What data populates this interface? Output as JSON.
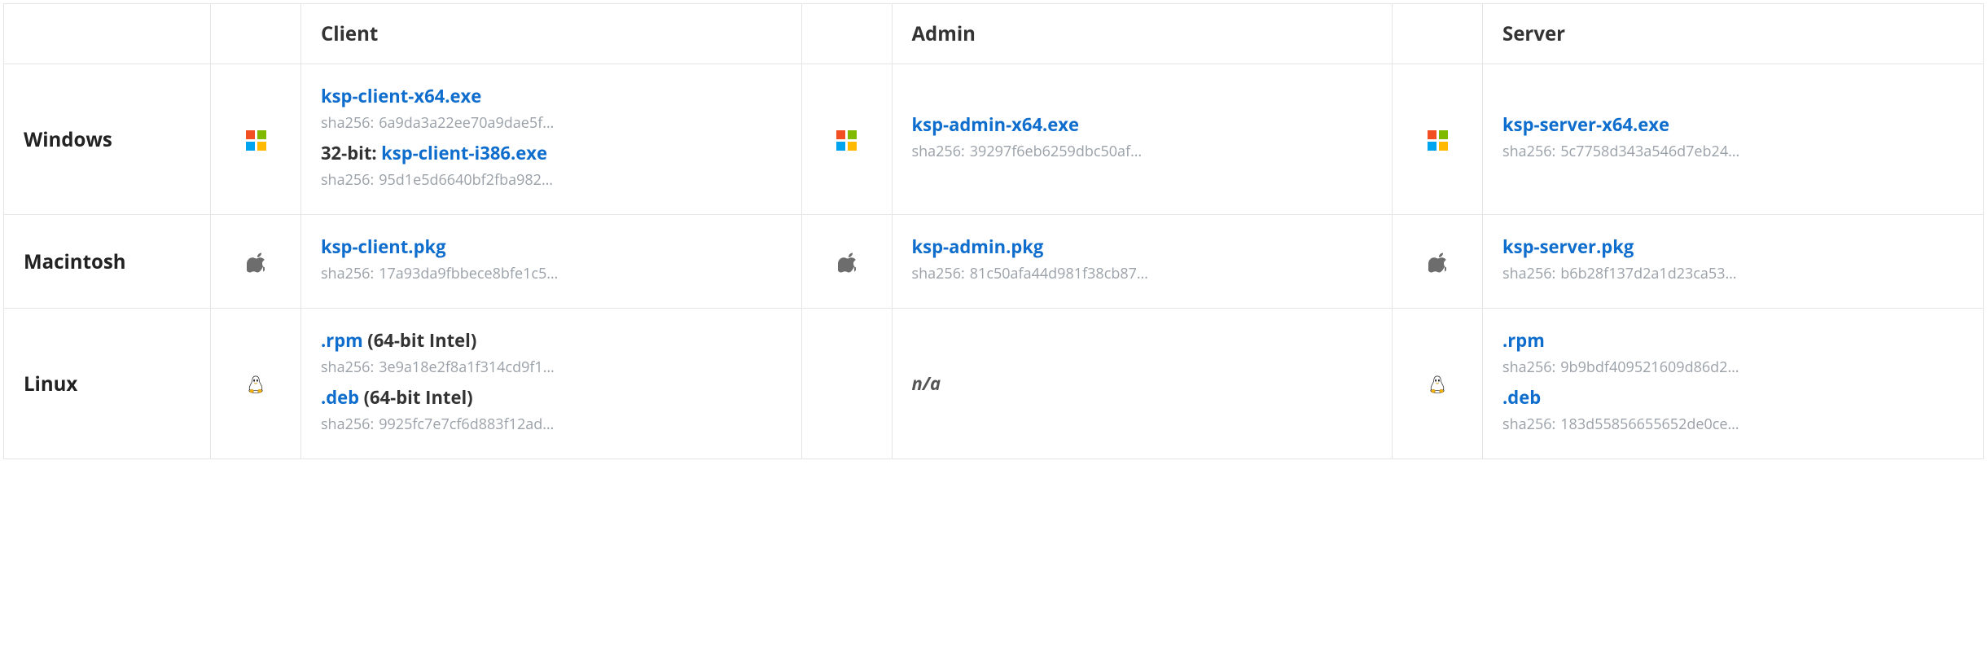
{
  "headers": {
    "client": "Client",
    "admin": "Admin",
    "server": "Server"
  },
  "os": {
    "windows": "Windows",
    "mac": "Macintosh",
    "linux": "Linux"
  },
  "labels": {
    "sha_prefix": "sha256:",
    "bit32_prefix": "32-bit:",
    "arch64_intel": "(64-bit Intel)",
    "na": "n/a"
  },
  "downloads": {
    "windows": {
      "client": {
        "file": "ksp-client-x64.exe",
        "sha": "6a9da3a22ee70a9dae5f…",
        "file32": "ksp-client-i386.exe",
        "sha32": "95d1e5d6640bf2fba982…"
      },
      "admin": {
        "file": "ksp-admin-x64.exe",
        "sha": "39297f6eb6259dbc50af…"
      },
      "server": {
        "file": "ksp-server-x64.exe",
        "sha": "5c7758d343a546d7eb24…"
      }
    },
    "mac": {
      "client": {
        "file": "ksp-client.pkg",
        "sha": "17a93da9fbbece8bfe1c5…"
      },
      "admin": {
        "file": "ksp-admin.pkg",
        "sha": "81c50afa44d981f38cb87…"
      },
      "server": {
        "file": "ksp-server.pkg",
        "sha": "b6b28f137d2a1d23ca53…"
      }
    },
    "linux": {
      "client": {
        "rpm_label": ".rpm",
        "rpm_sha": "3e9a18e2f8a1f314cd9f1…",
        "deb_label": ".deb",
        "deb_sha": "9925fc7e7cf6d883f12ad…"
      },
      "server": {
        "rpm_label": ".rpm",
        "rpm_sha": "9b9bdf409521609d86d2…",
        "deb_label": ".deb",
        "deb_sha": "183d55856655652de0ce…"
      }
    }
  }
}
